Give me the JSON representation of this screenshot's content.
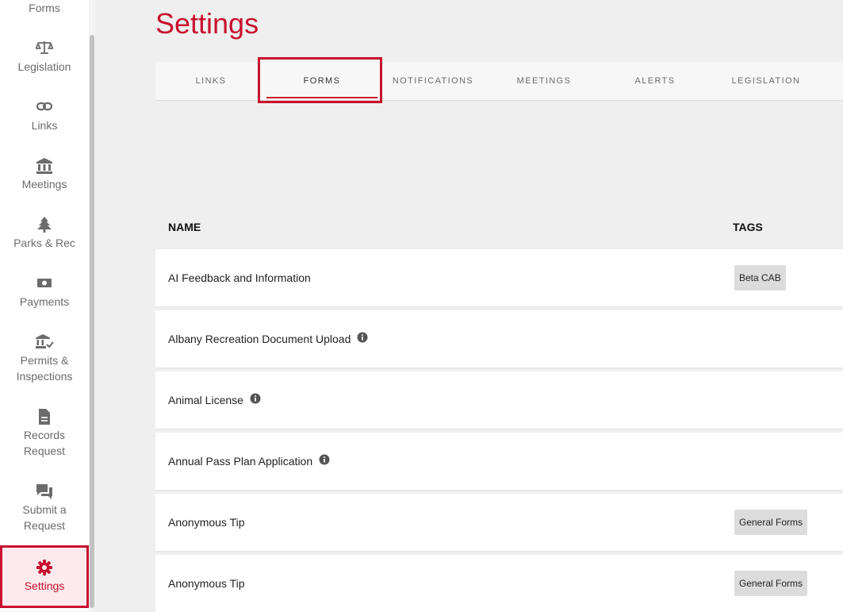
{
  "sidebar": {
    "items": [
      {
        "label": "Forms",
        "icon": "forms-icon"
      },
      {
        "label": "Legislation",
        "icon": "scales-icon"
      },
      {
        "label": "Links",
        "icon": "link-icon"
      },
      {
        "label": "Meetings",
        "icon": "building-icon"
      },
      {
        "label": "Parks & Rec",
        "icon": "tree-icon"
      },
      {
        "label": "Payments",
        "icon": "money-icon"
      },
      {
        "label": "Permits &",
        "label2": "Inspections",
        "icon": "permit-building-icon"
      },
      {
        "label": "Records",
        "label2": "Request",
        "icon": "document-icon"
      },
      {
        "label": "Submit a",
        "label2": "Request",
        "icon": "chat-icon"
      },
      {
        "label": "Settings",
        "icon": "gear-icon",
        "active": true
      }
    ]
  },
  "page": {
    "title": "Settings"
  },
  "tabs": [
    {
      "label": "LINKS"
    },
    {
      "label": "FORMS",
      "active": true
    },
    {
      "label": "NOTIFICATIONS"
    },
    {
      "label": "MEETINGS"
    },
    {
      "label": "ALERTS"
    },
    {
      "label": "LEGISLATION"
    }
  ],
  "table": {
    "headers": {
      "name": "NAME",
      "tags": "TAGS"
    },
    "rows": [
      {
        "name": "AI Feedback and Information",
        "info": false,
        "tag": "Beta CAB"
      },
      {
        "name": "Albany Recreation Document Upload",
        "info": true,
        "tag": ""
      },
      {
        "name": "Animal License",
        "info": true,
        "tag": ""
      },
      {
        "name": "Annual Pass Plan Application",
        "info": true,
        "tag": ""
      },
      {
        "name": "Anonymous Tip",
        "info": false,
        "tag": "General Forms"
      },
      {
        "name": "Anonymous Tip",
        "info": false,
        "tag": "General Forms"
      }
    ]
  },
  "colors": {
    "accent": "#c8102e",
    "sidebar_text": "#6b6b6b",
    "background": "#efefef"
  }
}
